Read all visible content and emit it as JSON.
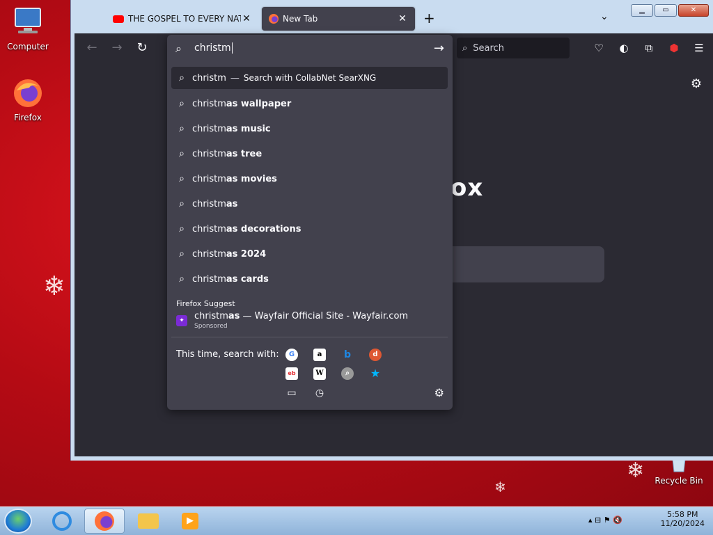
{
  "desktop": {
    "icons": [
      {
        "label": "Computer"
      },
      {
        "label": "Firefox"
      },
      {
        "label": "Recycle Bin"
      }
    ]
  },
  "browser": {
    "tabs": [
      {
        "title": "THE GOSPEL TO EVERY NATION",
        "icon": "youtube-icon"
      },
      {
        "title": "New Tab",
        "icon": "firefox-icon"
      }
    ],
    "toolbar": {
      "search_placeholder": "Search"
    },
    "urlbar": {
      "typed": "christm",
      "primary_row": {
        "query": "christm",
        "separator": "—",
        "engine_text": "Search with CollabNet SearXNG"
      },
      "suggestions": [
        {
          "prefix": "christm",
          "suffix": "as wallpaper"
        },
        {
          "prefix": "christm",
          "suffix": "as music"
        },
        {
          "prefix": "christm",
          "suffix": "as tree"
        },
        {
          "prefix": "christm",
          "suffix": "as movies"
        },
        {
          "prefix": "christm",
          "suffix": "as"
        },
        {
          "prefix": "christm",
          "suffix": "as decorations"
        },
        {
          "prefix": "christm",
          "suffix": "as 2024"
        },
        {
          "prefix": "christm",
          "suffix": "as cards"
        }
      ],
      "firefox_suggest_label": "Firefox Suggest",
      "sponsored": {
        "prefix": "christm",
        "bold": "as",
        "rest": " — Wayfair Official Site - Wayfair.com",
        "tag": "Sponsored"
      },
      "this_time_label": "This time, search with:",
      "engines": [
        "google-icon",
        "amazon-icon",
        "bing-icon",
        "duckduckgo-icon",
        "ebay-icon",
        "wikipedia-icon",
        "searxng-icon",
        "bookmarks-star-icon",
        "tabs-icon",
        "history-icon"
      ]
    },
    "newtab": {
      "brand_fragment": "ox"
    }
  },
  "taskbar": {
    "time": "5:58 PM",
    "date": "11/20/2024"
  },
  "colors": {
    "panel_bg": "#42414d",
    "toolbar_bg": "#2b2a33",
    "desktop_red": "#c80f18"
  }
}
